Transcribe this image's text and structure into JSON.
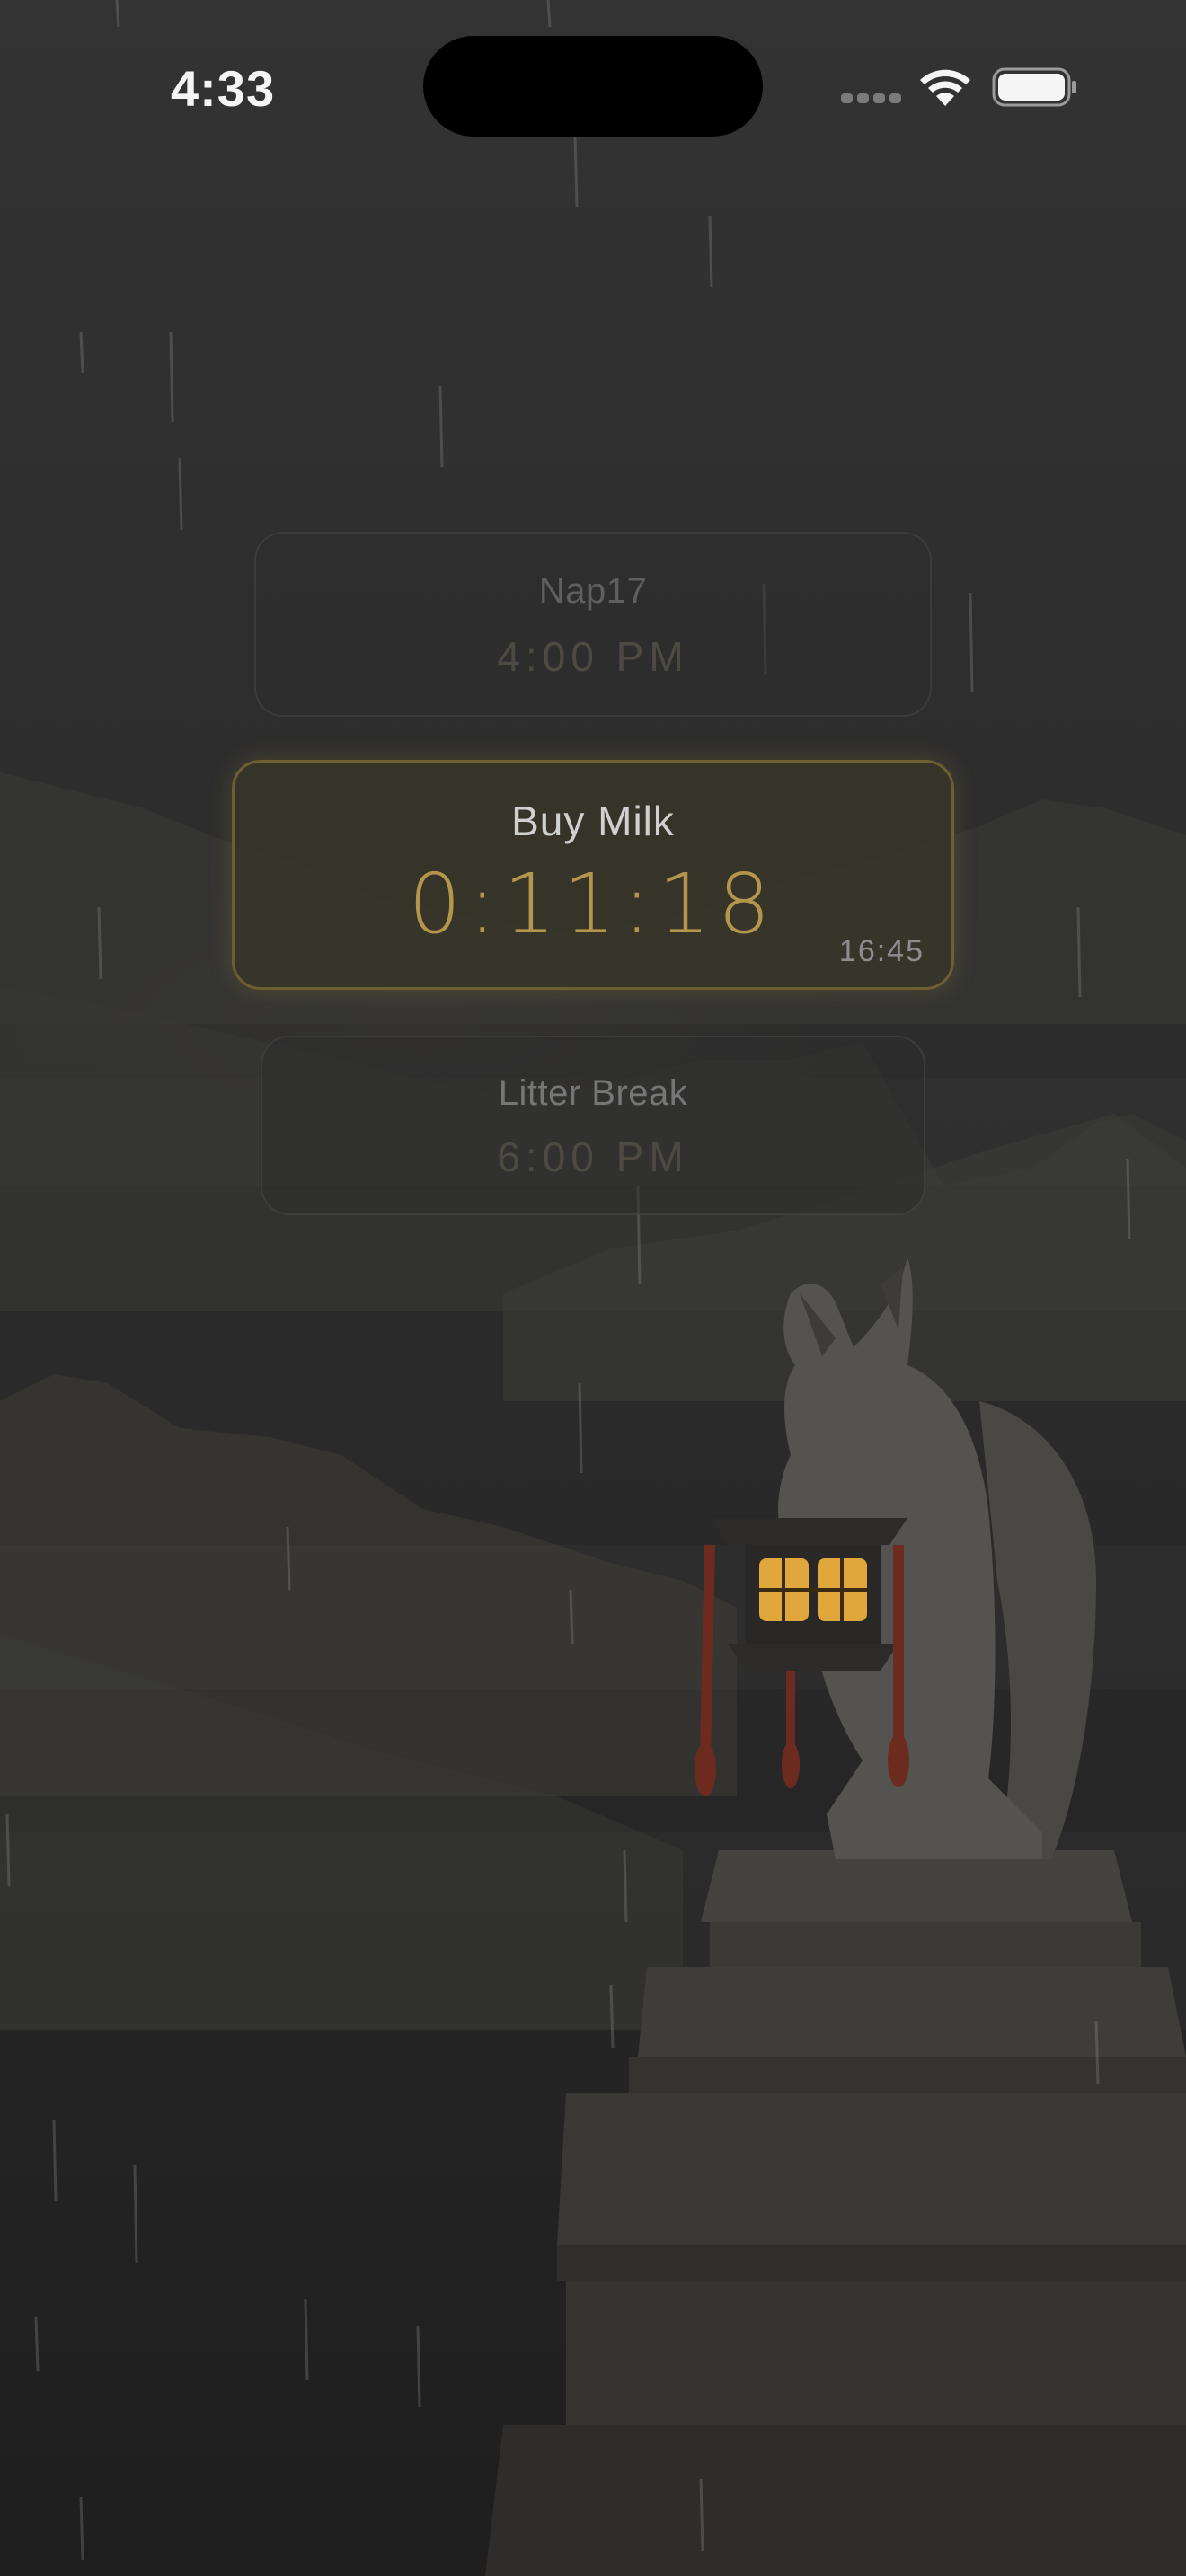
{
  "status_bar": {
    "time": "4:33"
  },
  "timers": [
    {
      "name": "Nap17",
      "time": "4:00 PM",
      "state": "upcoming"
    },
    {
      "name": "Buy Milk",
      "countdown": "0:11:18",
      "end_time": "16:45",
      "state": "active"
    },
    {
      "name": "Litter Break",
      "time": "6:00 PM",
      "state": "upcoming"
    }
  ],
  "colors": {
    "accent": "#b3964c",
    "active_border": "#6d5f31",
    "lantern_glow": "#e0a73c",
    "background": "#2b2b2b"
  },
  "icons": [
    "wifi-icon",
    "battery-icon",
    "cellular-signal-icon"
  ]
}
